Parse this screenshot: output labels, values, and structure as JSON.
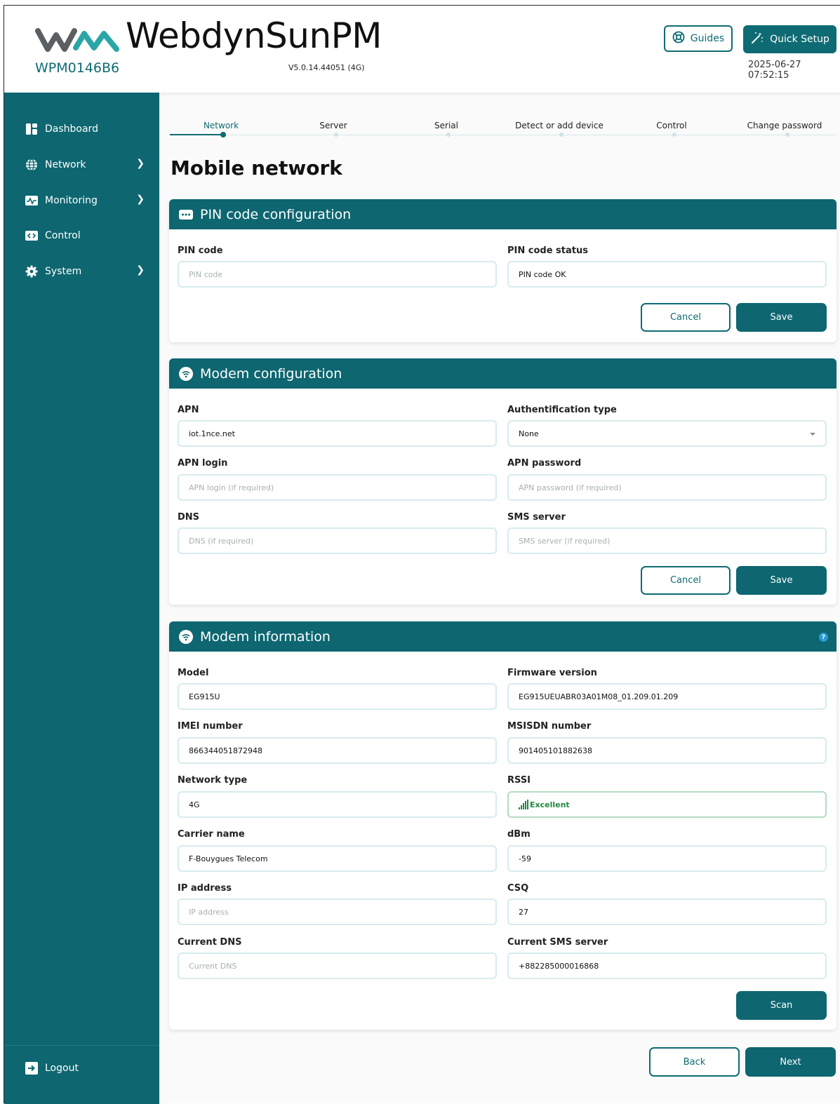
{
  "header": {
    "brand": "WebdynSunPM",
    "device_id": "WPM0146B6",
    "version": "V5.0.14.44051 (4G)",
    "guides_label": "Guides",
    "quick_setup_label": "Quick Setup",
    "datetime": "2025-06-27 07:52:15"
  },
  "sidebar": {
    "items": [
      {
        "label": "Dashboard",
        "icon": "dashboard-icon",
        "has_submenu": false
      },
      {
        "label": "Network",
        "icon": "globe-icon",
        "has_submenu": true
      },
      {
        "label": "Monitoring",
        "icon": "monitoring-icon",
        "has_submenu": true
      },
      {
        "label": "Control",
        "icon": "code-icon",
        "has_submenu": false
      },
      {
        "label": "System",
        "icon": "gear-icon",
        "has_submenu": true
      }
    ],
    "logout_label": "Logout"
  },
  "stepper": {
    "steps": [
      "Network",
      "Server",
      "Serial",
      "Detect or add device",
      "Control",
      "Change password"
    ],
    "active_index": 0
  },
  "page_title": "Mobile network",
  "pin_card": {
    "title": "PIN code configuration",
    "pin_label": "PIN code",
    "pin_placeholder": "PIN code",
    "status_label": "PIN code status",
    "status_value": "PIN code OK",
    "cancel_label": "Cancel",
    "save_label": "Save"
  },
  "modem_config": {
    "title": "Modem configuration",
    "apn_label": "APN",
    "apn_value": "iot.1nce.net",
    "auth_label": "Authentification type",
    "auth_value": "None",
    "apn_login_label": "APN login",
    "apn_login_placeholder": "APN login (if required)",
    "apn_password_label": "APN password",
    "apn_password_placeholder": "APN password (if required)",
    "dns_label": "DNS",
    "dns_placeholder": "DNS (if required)",
    "sms_label": "SMS server",
    "sms_placeholder": "SMS server (if required)",
    "cancel_label": "Cancel",
    "save_label": "Save"
  },
  "modem_info": {
    "title": "Modem information",
    "help_label": "?",
    "model_label": "Model",
    "model_value": "EG915U",
    "firmware_label": "Firmware version",
    "firmware_value": "EG915UEUABR03A01M08_01.209.01.209",
    "imei_label": "IMEI number",
    "imei_value": "866344051872948",
    "msisdn_label": "MSISDN number",
    "msisdn_value": "901405101882638",
    "network_type_label": "Network type",
    "network_type_value": "4G",
    "rssi_label": "RSSI",
    "rssi_value": "Excellent",
    "rssi_color": "#1e8a3f",
    "carrier_label": "Carrier name",
    "carrier_value": "F-Bouygues Telecom",
    "dbm_label": "dBm",
    "dbm_value": "-59",
    "ip_label": "IP address",
    "ip_placeholder": "IP address",
    "csq_label": "CSQ",
    "csq_value": "27",
    "current_dns_label": "Current DNS",
    "current_dns_placeholder": "Current DNS",
    "current_sms_label": "Current SMS server",
    "current_sms_value": "+882285000016868",
    "scan_label": "Scan"
  },
  "footer": {
    "back_label": "Back",
    "next_label": "Next"
  },
  "colors": {
    "primary": "#0d6670",
    "accent_text": "#0e6b73",
    "field_border": "#d7ebed"
  }
}
